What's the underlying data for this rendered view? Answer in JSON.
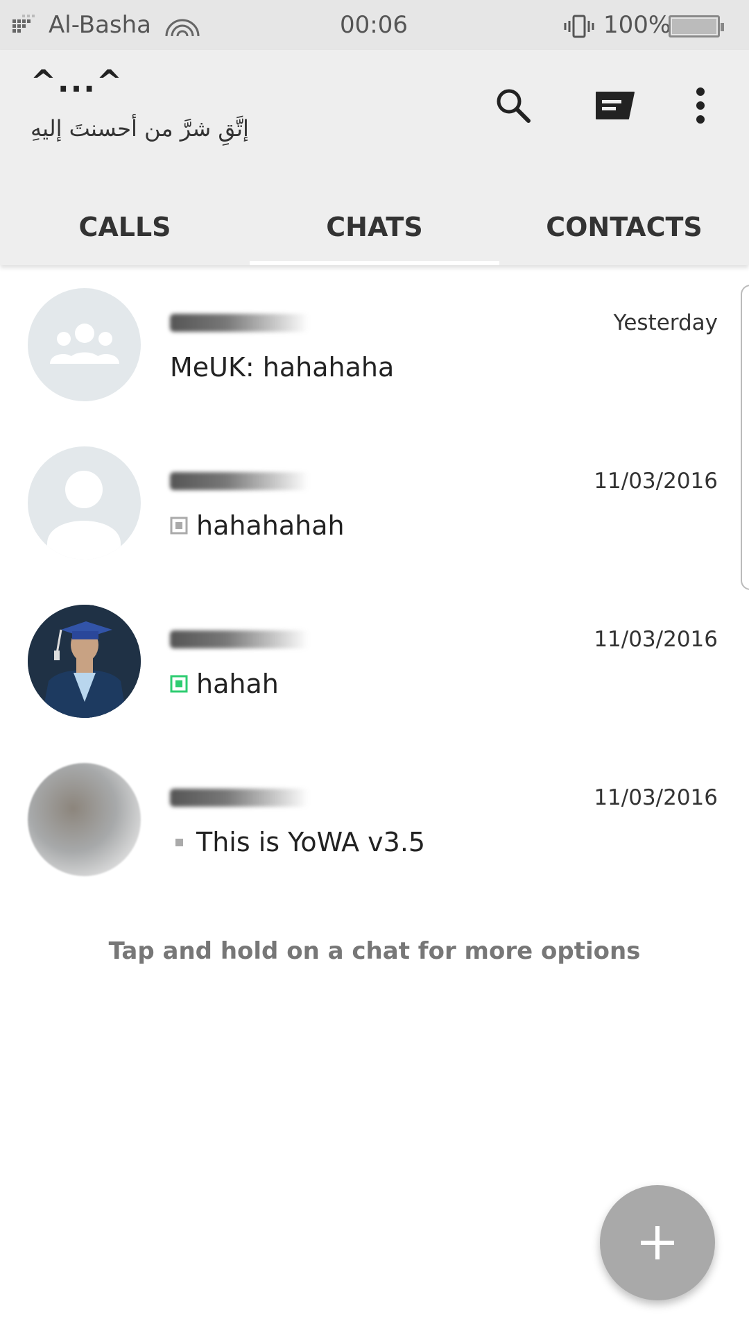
{
  "status_bar": {
    "carrier": "Al-Basha",
    "time": "00:06",
    "battery": "100%",
    "battery_level": 1.0
  },
  "header": {
    "title": "^...^",
    "subtitle": "إتَّقِ شرَّ من أحسنتَ إليهِ",
    "icons": [
      "search-icon",
      "compose-icon",
      "more-vert-icon"
    ]
  },
  "tabs": [
    {
      "label": "CALLS",
      "active": false
    },
    {
      "label": "CHATS",
      "active": true
    },
    {
      "label": "CONTACTS",
      "active": false
    }
  ],
  "chats": [
    {
      "time": "Yesterday",
      "message": "MeUK: hahahaha",
      "avatar": "group-avatar-icon"
    },
    {
      "time": "11/03/2016",
      "message": "hahahahah",
      "avatar": "person-avatar-icon",
      "status_icon": "sent-icon"
    },
    {
      "time": "11/03/2016",
      "message": "hahah",
      "avatar": "graduate-photo",
      "status_icon": "read-icon"
    },
    {
      "time": "11/03/2016",
      "message": "This is YoWA v3.5",
      "avatar": "blurred-photo",
      "status_icon": "pending-icon"
    }
  ],
  "hint": "Tap and hold on a chat for more options",
  "colors": {
    "header_bg": "#eeeeee",
    "status_bg": "#e6e6e6",
    "fab": "#a9a9a9",
    "read_green": "#2ecc71"
  }
}
